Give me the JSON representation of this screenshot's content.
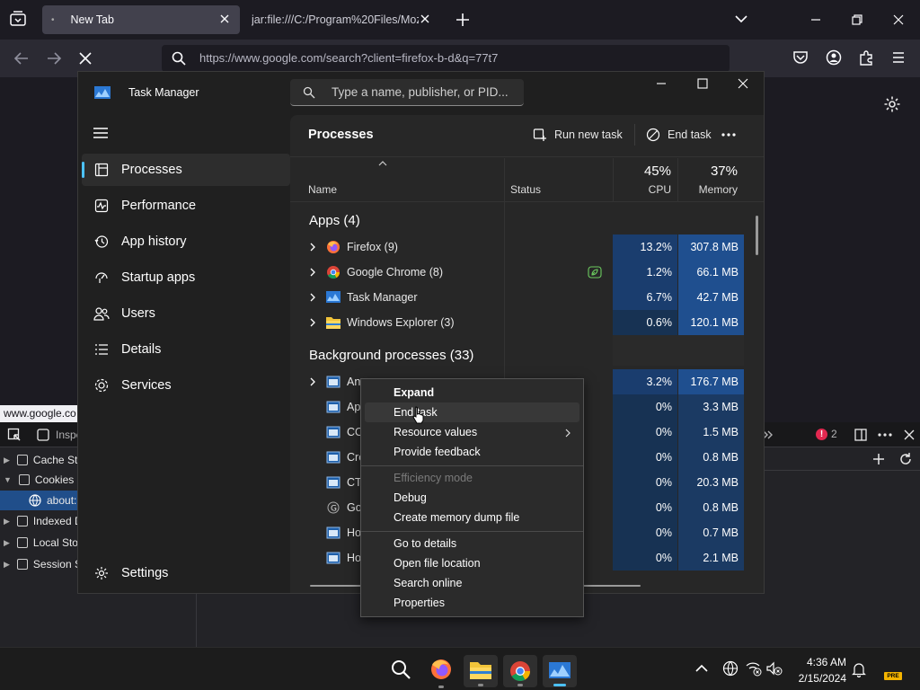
{
  "browser": {
    "tabs": [
      {
        "title": "New Tab"
      },
      {
        "title": "jar:file:///C:/Program%20Files/Moz"
      }
    ],
    "url": "https://www.google.com/search?client=firefox-b-d&q=77t7",
    "status_url": "www.google.co",
    "devtools": {
      "inspector_label": "Inspe",
      "error_count": "2",
      "tree": [
        {
          "label": "Cache Sto"
        },
        {
          "label": "Cookies"
        },
        {
          "label": "about:"
        },
        {
          "label": "Indexed D"
        },
        {
          "label": "Local Stor"
        },
        {
          "label": "Session S"
        }
      ]
    }
  },
  "task_manager": {
    "title": "Task Manager",
    "search_placeholder": "Type a name, publisher, or PID...",
    "nav": [
      {
        "label": "Processes",
        "icon": "processes-icon",
        "selected": true
      },
      {
        "label": "Performance",
        "icon": "performance-icon"
      },
      {
        "label": "App history",
        "icon": "app-history-icon"
      },
      {
        "label": "Startup apps",
        "icon": "startup-apps-icon"
      },
      {
        "label": "Users",
        "icon": "users-icon"
      },
      {
        "label": "Details",
        "icon": "details-icon"
      },
      {
        "label": "Services",
        "icon": "services-icon"
      }
    ],
    "settings_label": "Settings",
    "header": {
      "title": "Processes",
      "run_new_task": "Run new task",
      "end_task": "End task"
    },
    "columns": {
      "name": "Name",
      "status": "Status",
      "cpu_pct": "45%",
      "cpu": "CPU",
      "mem_pct": "37%",
      "memory": "Memory"
    },
    "apps_group": "Apps (4)",
    "apps": [
      {
        "name": "Firefox (9)",
        "cpu": "13.2%",
        "memory": "307.8 MB",
        "icon": "firefox-icon"
      },
      {
        "name": "Google Chrome (8)",
        "cpu": "1.2%",
        "memory": "66.1 MB",
        "icon": "chrome-icon",
        "status_icon": "leaf-icon"
      },
      {
        "name": "Task Manager",
        "cpu": "6.7%",
        "memory": "42.7 MB",
        "icon": "task-manager-icon"
      },
      {
        "name": "Windows Explorer (3)",
        "cpu": "0.6%",
        "memory": "120.1 MB",
        "icon": "folder-icon"
      }
    ],
    "bg_group": "Background processes (33)",
    "bg": [
      {
        "name": "An",
        "cpu": "3.2%",
        "memory": "176.7 MB"
      },
      {
        "name": "Ap",
        "cpu": "0%",
        "memory": "3.3 MB"
      },
      {
        "name": "CO",
        "cpu": "0%",
        "memory": "1.5 MB"
      },
      {
        "name": "Cre",
        "cpu": "0%",
        "memory": "0.8 MB"
      },
      {
        "name": "CT",
        "cpu": "0%",
        "memory": "20.3 MB"
      },
      {
        "name": "Go",
        "cpu": "0%",
        "memory": "0.8 MB"
      },
      {
        "name": "Ho",
        "cpu": "0%",
        "memory": "0.7 MB"
      },
      {
        "name": "Ho",
        "cpu": "0%",
        "memory": "2.1 MB"
      }
    ]
  },
  "context_menu": {
    "expand": "Expand",
    "end_task": "End task",
    "resource_values": "Resource values",
    "provide_feedback": "Provide feedback",
    "efficiency_mode": "Efficiency mode",
    "debug": "Debug",
    "create_dump": "Create memory dump file",
    "go_to_details": "Go to details",
    "open_file_location": "Open file location",
    "search_online": "Search online",
    "properties": "Properties"
  },
  "taskbar": {
    "time": "4:36 AM",
    "date": "2/15/2024",
    "badge": "PRE"
  }
}
